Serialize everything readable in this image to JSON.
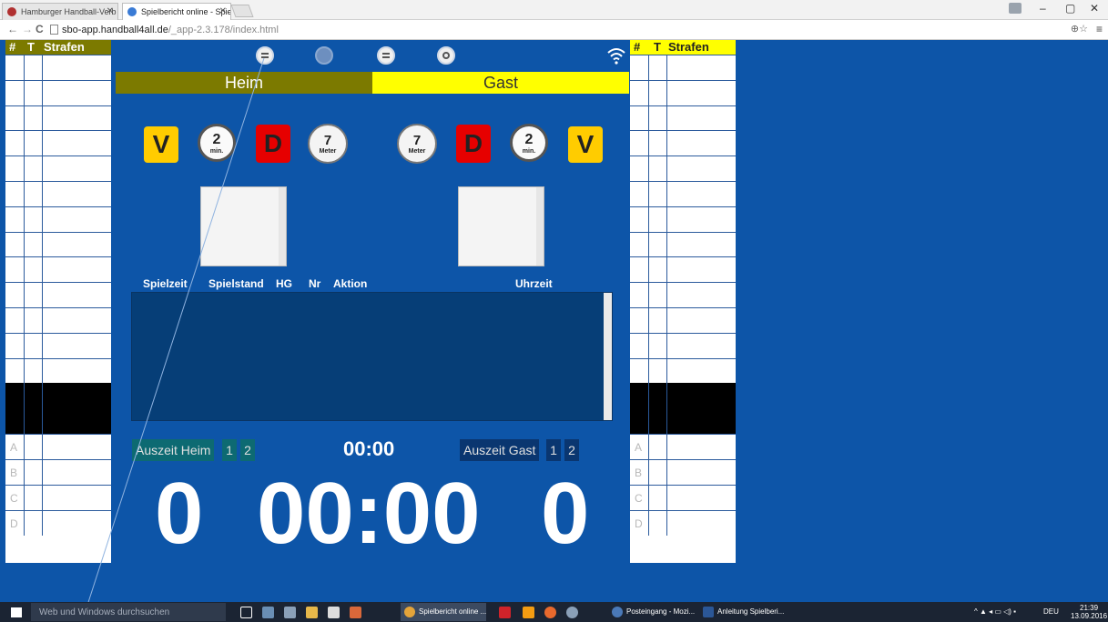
{
  "browser": {
    "tabs": [
      {
        "label": "Hamburger Handball-Verb",
        "active": false
      },
      {
        "label": "Spielbericht online - Spiel",
        "active": true
      }
    ],
    "url_host": "sbo-app.handball4all.de",
    "url_path": "/_app-2.3.178/index.html",
    "controls": {
      "minimize": "–",
      "restore": "▢",
      "close": "✕"
    }
  },
  "toolbar": {
    "icons": [
      "keypad-icon",
      "compass-icon",
      "list-icon",
      "settings-icon"
    ],
    "wifi": "wifi-icon"
  },
  "left_table": {
    "header": {
      "hash": "#",
      "t": "T",
      "strafen": "Strafen"
    },
    "header_color": "#7c7a00",
    "officials": [
      "A",
      "B",
      "C",
      "D"
    ]
  },
  "right_table": {
    "header": {
      "hash": "#",
      "t": "T",
      "strafen": "Strafen"
    },
    "header_color": "#ffff00",
    "officials": [
      "A",
      "B",
      "C",
      "D"
    ]
  },
  "teams": {
    "home": {
      "label": "Heim",
      "color": "#7c7a00"
    },
    "guest": {
      "label": "Gast",
      "color": "#ffff00"
    }
  },
  "actions": {
    "v_label": "V",
    "d_label": "D",
    "two_min_number": "2",
    "two_min_unit": "min.",
    "seven_m_number": "7",
    "seven_m_unit": "Meter"
  },
  "log": {
    "columns": {
      "spielzeit": "Spielzeit",
      "spielstand": "Spielstand",
      "hg": "HG",
      "nr": "Nr",
      "aktion": "Aktion",
      "uhrzeit": "Uhrzeit"
    }
  },
  "timeouts": {
    "home_label": "Auszeit Heim",
    "guest_label": "Auszeit Gast",
    "one": "1",
    "two": "2",
    "clock": "00:00"
  },
  "scoreboard": {
    "home_score": "0",
    "game_time": "00:00",
    "guest_score": "0"
  },
  "taskbar": {
    "search_placeholder": "Web und Windows durchsuchen",
    "apps": [
      {
        "label": "Spielbericht online ...",
        "active": true
      },
      {
        "label": "Posteingang - Mozi...",
        "active": false
      },
      {
        "label": "Anleitung Spielberi...",
        "active": false
      }
    ],
    "language": "DEU",
    "time": "21:39",
    "date": "13.09.2016"
  }
}
